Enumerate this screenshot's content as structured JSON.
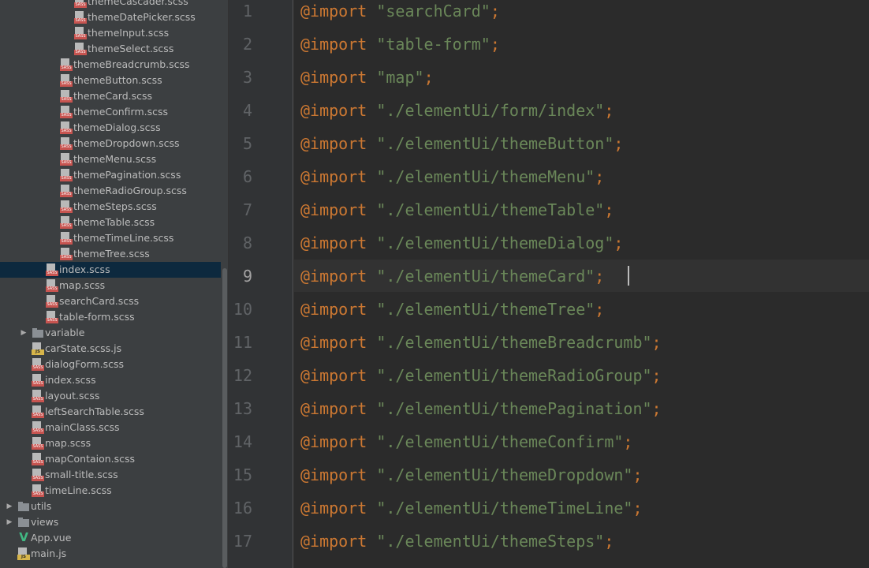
{
  "project_tree": {
    "items": [
      {
        "label": "themeCascader.scss",
        "type": "sass",
        "indent": 5,
        "expandable": false,
        "selected": false
      },
      {
        "label": "themeDatePicker.scss",
        "type": "sass",
        "indent": 5,
        "expandable": false,
        "selected": false
      },
      {
        "label": "themeInput.scss",
        "type": "sass",
        "indent": 5,
        "expandable": false,
        "selected": false
      },
      {
        "label": "themeSelect.scss",
        "type": "sass",
        "indent": 5,
        "expandable": false,
        "selected": false
      },
      {
        "label": "themeBreadcrumb.scss",
        "type": "sass",
        "indent": 4,
        "expandable": false,
        "selected": false
      },
      {
        "label": "themeButton.scss",
        "type": "sass",
        "indent": 4,
        "expandable": false,
        "selected": false
      },
      {
        "label": "themeCard.scss",
        "type": "sass",
        "indent": 4,
        "expandable": false,
        "selected": false
      },
      {
        "label": "themeConfirm.scss",
        "type": "sass",
        "indent": 4,
        "expandable": false,
        "selected": false
      },
      {
        "label": "themeDialog.scss",
        "type": "sass",
        "indent": 4,
        "expandable": false,
        "selected": false
      },
      {
        "label": "themeDropdown.scss",
        "type": "sass",
        "indent": 4,
        "expandable": false,
        "selected": false
      },
      {
        "label": "themeMenu.scss",
        "type": "sass",
        "indent": 4,
        "expandable": false,
        "selected": false
      },
      {
        "label": "themePagination.scss",
        "type": "sass",
        "indent": 4,
        "expandable": false,
        "selected": false
      },
      {
        "label": "themeRadioGroup.scss",
        "type": "sass",
        "indent": 4,
        "expandable": false,
        "selected": false
      },
      {
        "label": "themeSteps.scss",
        "type": "sass",
        "indent": 4,
        "expandable": false,
        "selected": false
      },
      {
        "label": "themeTable.scss",
        "type": "sass",
        "indent": 4,
        "expandable": false,
        "selected": false
      },
      {
        "label": "themeTimeLine.scss",
        "type": "sass",
        "indent": 4,
        "expandable": false,
        "selected": false
      },
      {
        "label": "themeTree.scss",
        "type": "sass",
        "indent": 4,
        "expandable": false,
        "selected": false
      },
      {
        "label": "index.scss",
        "type": "sass",
        "indent": 3,
        "expandable": false,
        "selected": true
      },
      {
        "label": "map.scss",
        "type": "sass",
        "indent": 3,
        "expandable": false,
        "selected": false
      },
      {
        "label": "searchCard.scss",
        "type": "sass",
        "indent": 3,
        "expandable": false,
        "selected": false
      },
      {
        "label": "table-form.scss",
        "type": "sass",
        "indent": 3,
        "expandable": false,
        "selected": false
      },
      {
        "label": "variable",
        "type": "folder",
        "indent": 2,
        "expandable": true,
        "selected": false
      },
      {
        "label": "carState.scss.js",
        "type": "js",
        "indent": 2,
        "expandable": false,
        "selected": false
      },
      {
        "label": "dialogForm.scss",
        "type": "sass",
        "indent": 2,
        "expandable": false,
        "selected": false
      },
      {
        "label": "index.scss",
        "type": "sass",
        "indent": 2,
        "expandable": false,
        "selected": false
      },
      {
        "label": "layout.scss",
        "type": "sass",
        "indent": 2,
        "expandable": false,
        "selected": false
      },
      {
        "label": "leftSearchTable.scss",
        "type": "sass",
        "indent": 2,
        "expandable": false,
        "selected": false
      },
      {
        "label": "mainClass.scss",
        "type": "sass",
        "indent": 2,
        "expandable": false,
        "selected": false
      },
      {
        "label": "map.scss",
        "type": "sass",
        "indent": 2,
        "expandable": false,
        "selected": false
      },
      {
        "label": "mapContaion.scss",
        "type": "sass",
        "indent": 2,
        "expandable": false,
        "selected": false
      },
      {
        "label": "small-title.scss",
        "type": "sass",
        "indent": 2,
        "expandable": false,
        "selected": false
      },
      {
        "label": "timeLine.scss",
        "type": "sass",
        "indent": 2,
        "expandable": false,
        "selected": false
      },
      {
        "label": "utils",
        "type": "folder",
        "indent": 1,
        "expandable": true,
        "selected": false
      },
      {
        "label": "views",
        "type": "folder",
        "indent": 1,
        "expandable": true,
        "selected": false
      },
      {
        "label": "App.vue",
        "type": "vue",
        "indent": 1,
        "expandable": false,
        "selected": false
      },
      {
        "label": "main.js",
        "type": "js",
        "indent": 1,
        "expandable": false,
        "selected": false
      }
    ],
    "icon_badges": {
      "sass": "SASS",
      "js": "JS"
    }
  },
  "editor": {
    "current_line": 9,
    "lines": [
      {
        "number": "1",
        "keyword": "@import",
        "string": "\"searchCard\"",
        "terminator": ";"
      },
      {
        "number": "2",
        "keyword": "@import",
        "string": "\"table-form\"",
        "terminator": ";"
      },
      {
        "number": "3",
        "keyword": "@import",
        "string": "\"map\"",
        "terminator": ";"
      },
      {
        "number": "4",
        "keyword": "@import",
        "string": "\"./elementUi/form/index\"",
        "terminator": ";"
      },
      {
        "number": "5",
        "keyword": "@import",
        "string": "\"./elementUi/themeButton\"",
        "terminator": ";"
      },
      {
        "number": "6",
        "keyword": "@import",
        "string": "\"./elementUi/themeMenu\"",
        "terminator": ";"
      },
      {
        "number": "7",
        "keyword": "@import",
        "string": "\"./elementUi/themeTable\"",
        "terminator": ";"
      },
      {
        "number": "8",
        "keyword": "@import",
        "string": "\"./elementUi/themeDialog\"",
        "terminator": ";"
      },
      {
        "number": "9",
        "keyword": "@import",
        "string": "\"./elementUi/themeCard\"",
        "terminator": ";"
      },
      {
        "number": "10",
        "keyword": "@import",
        "string": "\"./elementUi/themeTree\"",
        "terminator": ";"
      },
      {
        "number": "11",
        "keyword": "@import",
        "string": "\"./elementUi/themeBreadcrumb\"",
        "terminator": ";"
      },
      {
        "number": "12",
        "keyword": "@import",
        "string": "\"./elementUi/themeRadioGroup\"",
        "terminator": ";"
      },
      {
        "number": "13",
        "keyword": "@import",
        "string": "\"./elementUi/themePagination\"",
        "terminator": ";"
      },
      {
        "number": "14",
        "keyword": "@import",
        "string": "\"./elementUi/themeConfirm\"",
        "terminator": ";"
      },
      {
        "number": "15",
        "keyword": "@import",
        "string": "\"./elementUi/themeDropdown\"",
        "terminator": ";"
      },
      {
        "number": "16",
        "keyword": "@import",
        "string": "\"./elementUi/themeTimeLine\"",
        "terminator": ";"
      },
      {
        "number": "17",
        "keyword": "@import",
        "string": "\"./elementUi/themeSteps\"",
        "terminator": ";"
      }
    ]
  },
  "colors": {
    "tree_background": "#3c3f41",
    "tree_selection": "#0d293e",
    "editor_background": "#2b2b2b",
    "gutter_background": "#313335",
    "keyword": "#cc7832",
    "string": "#6a8759",
    "line_number": "#606366",
    "sass_badge": "#c75450",
    "js_badge": "#d7b54a",
    "vue_logo": "#41b883"
  }
}
